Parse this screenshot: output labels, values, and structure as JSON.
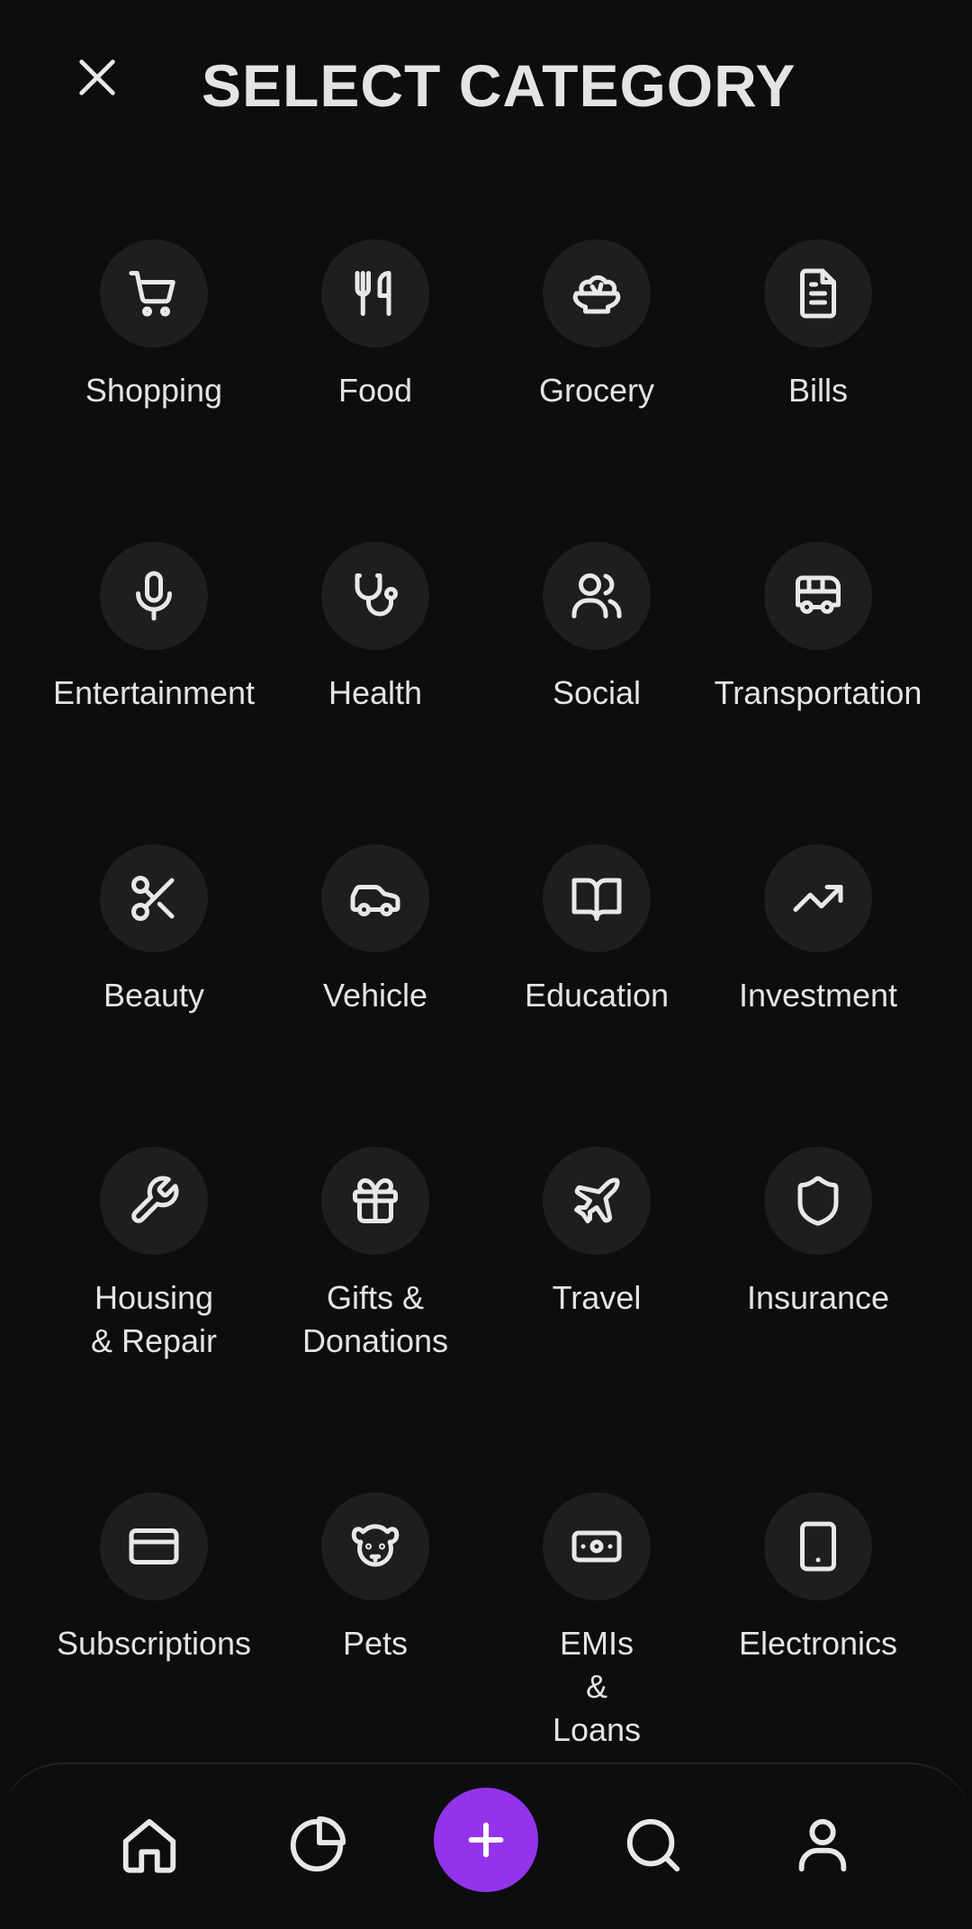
{
  "header": {
    "title": "SELECT CATEGORY"
  },
  "categories": [
    {
      "label": "Shopping",
      "icon": "shopping-cart-icon"
    },
    {
      "label": "Food",
      "icon": "utensils-icon"
    },
    {
      "label": "Grocery",
      "icon": "salad-bowl-icon"
    },
    {
      "label": "Bills",
      "icon": "document-icon"
    },
    {
      "label": "Entertainment",
      "icon": "microphone-icon"
    },
    {
      "label": "Health",
      "icon": "stethoscope-icon"
    },
    {
      "label": "Social",
      "icon": "users-icon"
    },
    {
      "label": "Transportation",
      "icon": "bus-icon"
    },
    {
      "label": "Beauty",
      "icon": "scissors-icon"
    },
    {
      "label": "Vehicle",
      "icon": "car-icon"
    },
    {
      "label": "Education",
      "icon": "book-open-icon"
    },
    {
      "label": "Investment",
      "icon": "trending-up-icon"
    },
    {
      "label": "Housing\n& Repair",
      "icon": "wrench-icon"
    },
    {
      "label": "Gifts &\nDonations",
      "icon": "gift-icon"
    },
    {
      "label": "Travel",
      "icon": "plane-icon"
    },
    {
      "label": "Insurance",
      "icon": "shield-icon"
    },
    {
      "label": "Subscriptions",
      "icon": "credit-card-icon"
    },
    {
      "label": "Pets",
      "icon": "dog-face-icon"
    },
    {
      "label": "EMIs\n&\nLoans",
      "icon": "banknote-icon"
    },
    {
      "label": "Electronics",
      "icon": "tablet-icon"
    }
  ],
  "bottom_nav": [
    {
      "icon": "home-icon"
    },
    {
      "icon": "pie-chart-icon"
    },
    {
      "icon": "plus-icon"
    },
    {
      "icon": "search-icon"
    },
    {
      "icon": "user-icon"
    }
  ],
  "colors": {
    "background": "#0d0d0e",
    "icon_circle": "#1e1e1f",
    "accent": "#9333ea",
    "text": "#e4e4e4"
  }
}
